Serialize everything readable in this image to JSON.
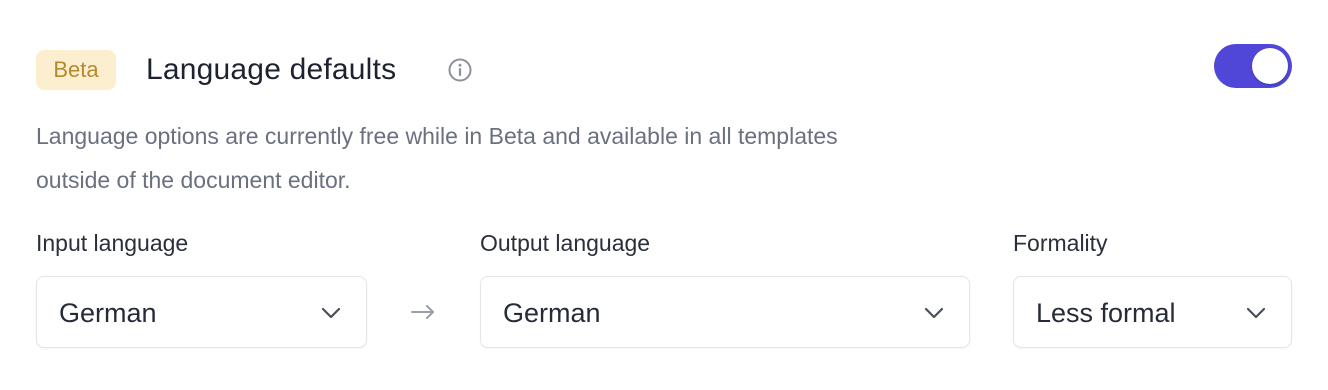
{
  "header": {
    "badge": "Beta",
    "title": "Language defaults",
    "info_icon": "info-circle-icon",
    "toggle_on": true,
    "toggle_color": "#5046d8"
  },
  "description": "Language options are currently free while in Beta and available in all templates outside of the document editor.",
  "fields": {
    "input_language": {
      "label": "Input language",
      "value": "German"
    },
    "output_language": {
      "label": "Output language",
      "value": "German"
    },
    "formality": {
      "label": "Formality",
      "value": "Less formal"
    }
  },
  "icons": {
    "arrow": "arrow-right-icon",
    "chevron": "chevron-down-icon"
  }
}
